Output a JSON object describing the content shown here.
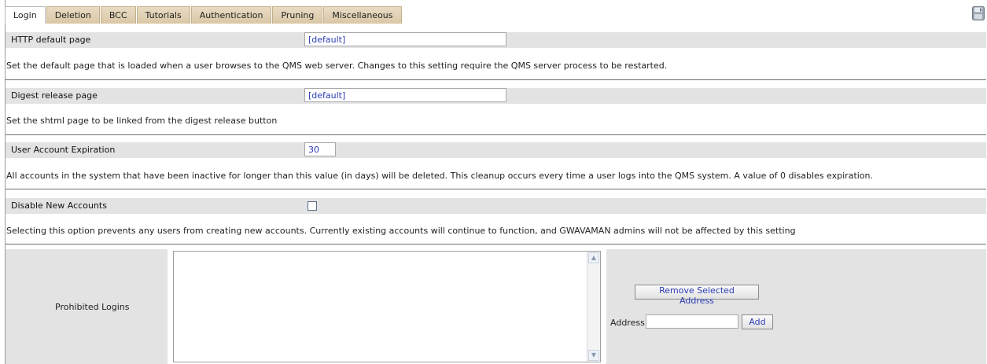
{
  "tabs": [
    "Login",
    "Deletion",
    "BCC",
    "Tutorials",
    "Authentication",
    "Pruning",
    "Miscellaneous"
  ],
  "active_tab": "Login",
  "icons": {
    "save": "save-icon",
    "scroll_up": "chevron-up-icon",
    "scroll_down": "chevron-down-icon"
  },
  "settings": {
    "http_default": {
      "label": "HTTP default page",
      "value": "[default]",
      "description": "Set the default page that is loaded when a user browses to the QMS web server. Changes to this setting require the QMS server process to be restarted."
    },
    "digest_release": {
      "label": "Digest release page",
      "value": "[default]",
      "description": "Set the shtml page to be linked from the digest release button"
    },
    "expiration": {
      "label": "User Account Expiration",
      "value": "30",
      "description": "All accounts in the system that have been inactive for longer than this value (in days) will be deleted. This cleanup occurs every time a user logs into the QMS system. A value of 0 disables expiration."
    },
    "disable_new": {
      "label": "Disable New Accounts",
      "checked": false,
      "description": "Selecting this option prevents any users from creating new accounts. Currently existing accounts will continue to function, and GWAVAMAN admins will not be affected by this setting"
    }
  },
  "prohibited": {
    "label": "Prohibited Logins",
    "items": [],
    "remove_button": "Remove Selected Address",
    "address_label": "Address",
    "address_value": "",
    "add_button": "Add"
  },
  "colors": {
    "tab_bg": "#d9c7a6",
    "row_bg": "#e3e3e3",
    "link_blue": "#2b3bb5"
  }
}
